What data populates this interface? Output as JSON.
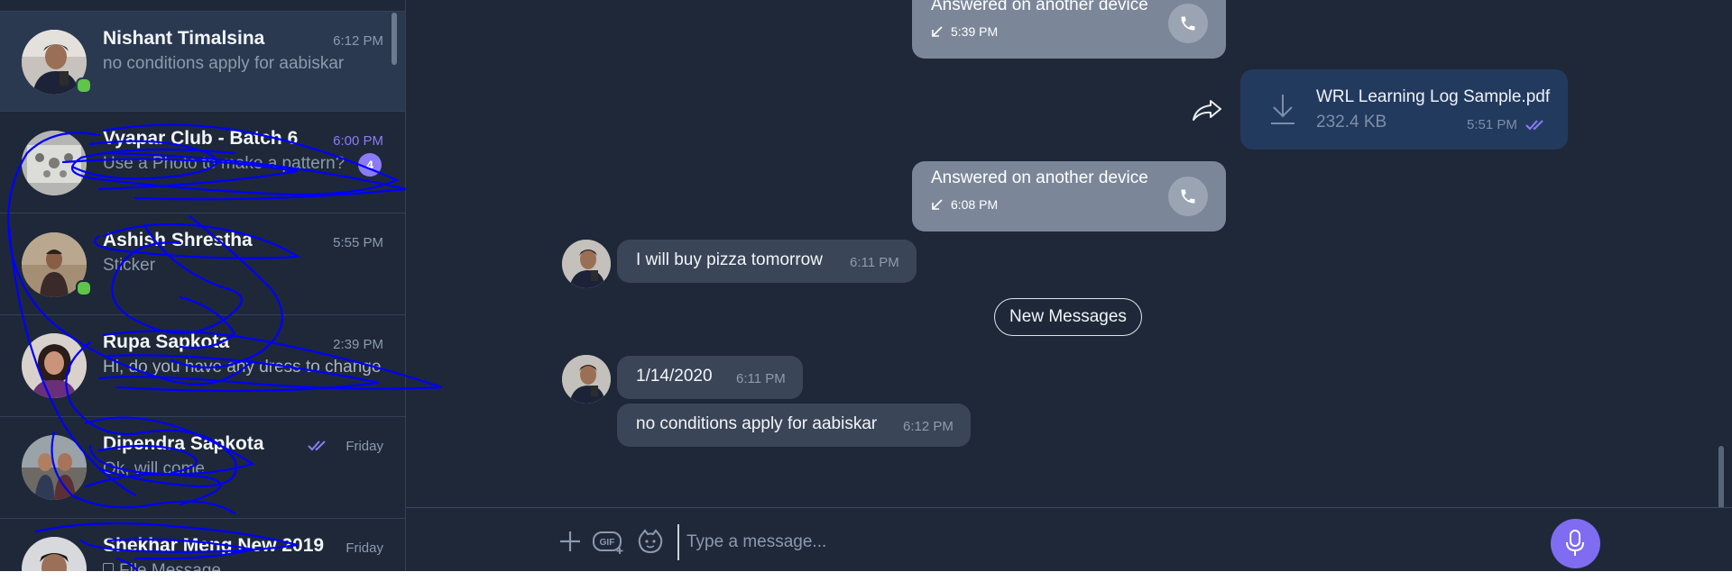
{
  "sidebar": {
    "chats": [
      {
        "name": "Nishant Timalsina",
        "preview": "no conditions apply for aabiskar",
        "time": "6:12 PM",
        "online": true,
        "active": true
      },
      {
        "name": "Vyapar Club - Batch 6",
        "preview": "Use a Photo to make a pattern?",
        "time": "6:00 PM",
        "unread_count": "4"
      },
      {
        "name": "Ashish Shrestha",
        "preview": "Sticker",
        "time": "5:55 PM",
        "online": true
      },
      {
        "name": "Rupa Sapkota",
        "preview": "Hi, do you have any dress to change",
        "time": "2:39 PM"
      },
      {
        "name": "Dipendra Sapkota",
        "preview": "Ok, will come",
        "time": "Friday",
        "read": true
      },
      {
        "name": "Shekhar Meng New 2019",
        "preview": "File Message",
        "time": "Friday"
      }
    ]
  },
  "conversation": {
    "calls": [
      {
        "text": "Answered on another device",
        "time": "5:39 PM"
      },
      {
        "text": "Answered on another device",
        "time": "6:08 PM"
      }
    ],
    "file": {
      "name": "WRL Learning Log Sample.pdf",
      "size": "232.4 KB",
      "time": "5:51 PM"
    },
    "messages": [
      {
        "text": "I will buy pizza tomorrow",
        "time": "6:11 PM"
      },
      {
        "text": "1/14/2020",
        "time": "6:11 PM"
      },
      {
        "text": "no conditions apply for aabiskar",
        "time": "6:12 PM"
      }
    ],
    "new_messages_label": "New Messages"
  },
  "composer": {
    "placeholder": "Type a message...",
    "gif_label": "GIF"
  },
  "colors": {
    "background": "#1e2838",
    "accent": "#8b7cf6",
    "online": "#5fc44a",
    "call_bubble": "#7b8799",
    "own_file_bubble": "#233a5f",
    "scribble": "#0000ff"
  },
  "icons": [
    "phone-icon",
    "call-arrow-icon",
    "download-icon",
    "forward-icon",
    "double-check-icon",
    "plus-icon",
    "gif-icon",
    "sticker-icon",
    "microphone-icon",
    "file-icon"
  ]
}
